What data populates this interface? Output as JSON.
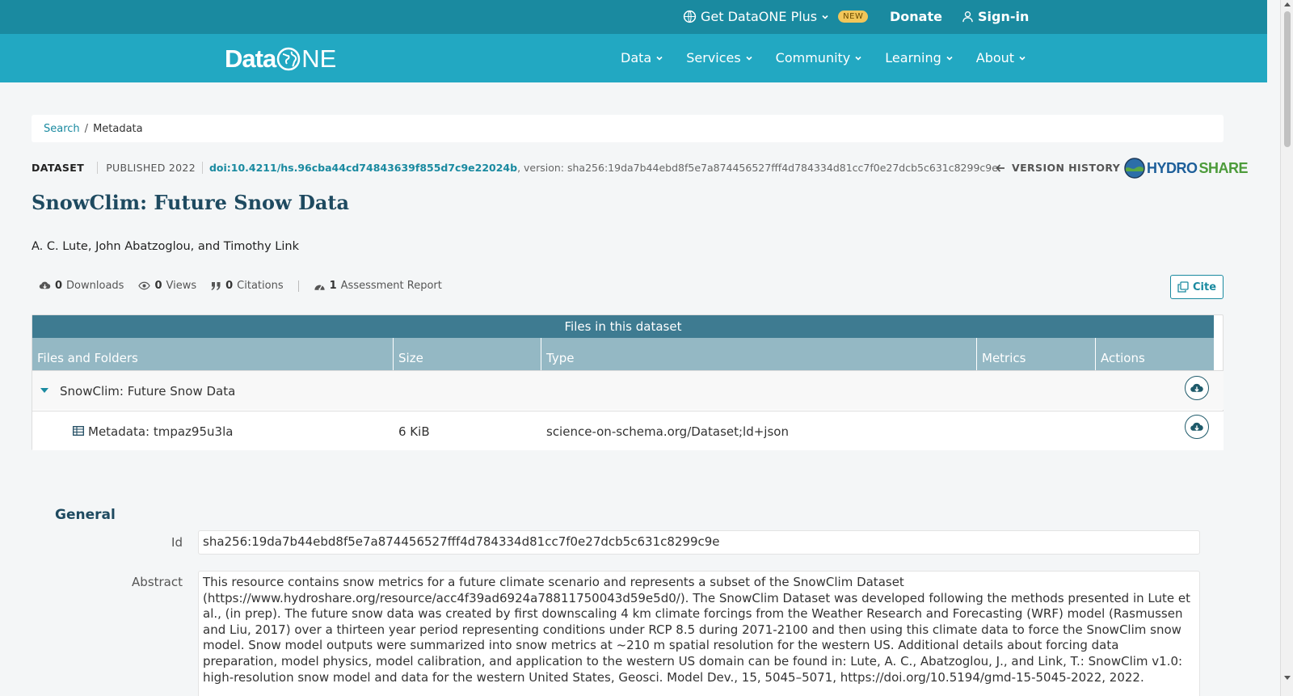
{
  "topbar": {
    "plus_label": "Get DataONE Plus",
    "badge": "NEW",
    "donate": "Donate",
    "signin": "Sign-in"
  },
  "nav": {
    "logo_text_a": "Data",
    "logo_text_b": "NE",
    "items": [
      "Data",
      "Services",
      "Community",
      "Learning",
      "About"
    ]
  },
  "breadcrumb": {
    "search": "Search",
    "separator": "/",
    "current": "Metadata"
  },
  "dataset": {
    "type": "DATASET",
    "published": "PUBLISHED 2022",
    "doi": "doi:10.4211/hs.96cba44cd74843639f855d7c9e22024b",
    "version_text": ", version: sha256:19da7b44ebd8f5e7a874456527fff4d784334d81cc7f0e27dcb5c631c8299c9e",
    "version_history": "VERSION HISTORY",
    "repo_logo_a": "HYDRO",
    "repo_logo_b": "SHARE",
    "title": "SnowClim: Future Snow Data",
    "authors": "A. C. Lute, John Abatzoglou, and Timothy Link"
  },
  "stats": {
    "downloads_count": "0",
    "downloads_label": "Downloads",
    "views_count": "0",
    "views_label": "Views",
    "citations_count": "0",
    "citations_label": "Citations",
    "assessment_count": "1",
    "assessment_label": "Assessment Report",
    "cite": "Cite"
  },
  "files": {
    "caption": "Files in this dataset",
    "columns": [
      "Files and Folders",
      "Size",
      "Type",
      "Metrics",
      "Actions"
    ],
    "folder": "SnowClim: Future Snow Data",
    "rows": [
      {
        "name": "Metadata: tmpaz95u3la",
        "size": "6 KiB",
        "type": "science-on-schema.org/Dataset;ld+json"
      }
    ]
  },
  "general": {
    "heading": "General",
    "id_label": "Id",
    "id_value": "sha256:19da7b44ebd8f5e7a874456527fff4d784334d81cc7f0e27dcb5c631c8299c9e",
    "abstract_label": "Abstract",
    "abstract_value": "This resource contains snow metrics for a future climate scenario and represents a subset of the SnowClim Dataset (https://www.hydroshare.org/resource/acc4f39ad6924a78811750043d59e5d0/). The SnowClim Dataset was developed following the methods presented in Lute et al., (in prep). The future snow data was created by first downscaling 4 km climate forcings from the Weather Research and Forecasting (WRF) model (Rasmussen and Liu, 2017) over a thirteen year period representing conditions under RCP 8.5 during 2071-2100 and then using this climate data to force the SnowClim snow model. Snow model outputs were summarized into snow metrics at ~210 m spatial resolution for the western US. Additional details about forcing data preparation, model physics, model calibration, and application to the western US domain can be found in: Lute, A. C., Abatzoglou, J., and Link, T.: SnowClim v1.0: high-resolution snow model and data for the western United States, Geosci. Model Dev., 15, 5045–5071, https://doi.org/10.5194/gmd-15-5045-2022, 2022."
  },
  "colors": {
    "topbar": "#1a8aa0",
    "nav": "#22a8c2",
    "accent": "#1a8aa0",
    "title": "#1e4a60",
    "table_caption": "#3e7b91",
    "table_header": "#94b8c4"
  }
}
